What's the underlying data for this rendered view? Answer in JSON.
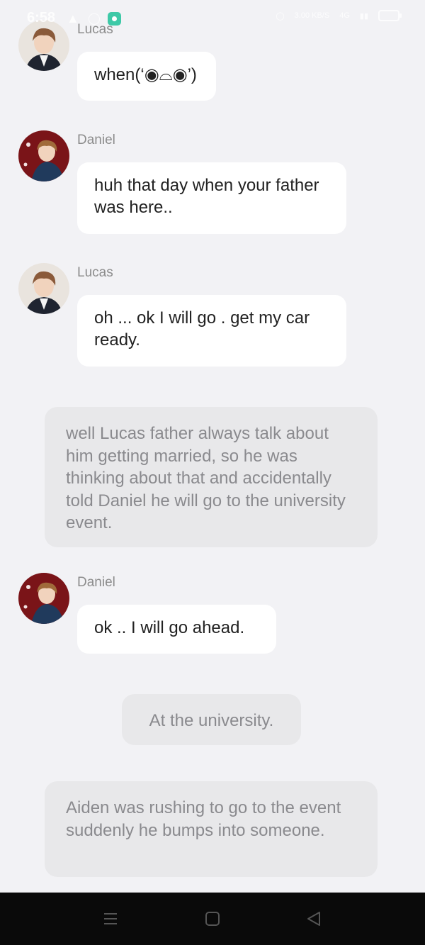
{
  "status_bar": {
    "time": "6:58",
    "speed": "3.00 KB/S",
    "network": "4G"
  },
  "messages": [
    {
      "type": "dialog",
      "name": "Lucas",
      "text": "when(‘◉⌓◉’)"
    },
    {
      "type": "dialog",
      "name": "Daniel",
      "text": "huh that day when your father was here.."
    },
    {
      "type": "dialog",
      "name": "Lucas",
      "text": "oh ... ok I will go . get my car ready."
    },
    {
      "type": "narration",
      "text": "well Lucas father always talk about him getting married, so he was thinking about that and accidentally told Daniel he will go to the university event."
    },
    {
      "type": "dialog",
      "name": "Daniel",
      "text": "ok .. I will go ahead."
    },
    {
      "type": "narration",
      "text": "At the university."
    },
    {
      "type": "narration",
      "text": "Aiden was rushing to go to the event suddenly he bumps into someone."
    }
  ],
  "nav_bar": {
    "icons": [
      "menu-icon",
      "home-icon",
      "back-icon"
    ]
  }
}
